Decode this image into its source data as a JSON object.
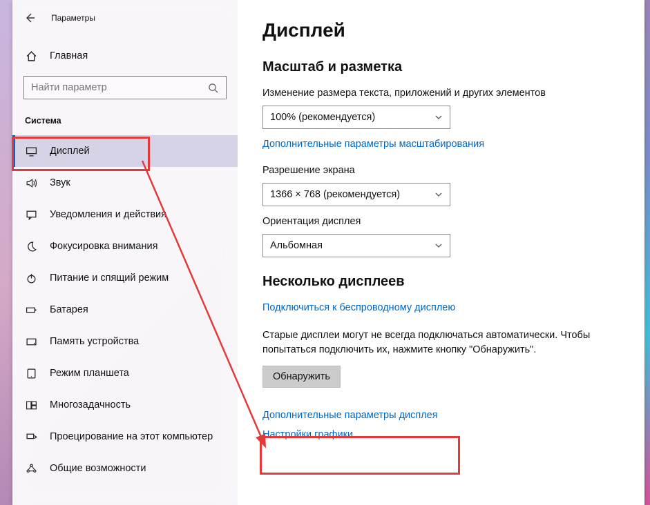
{
  "window": {
    "title": "Параметры"
  },
  "home": {
    "label": "Главная"
  },
  "search": {
    "placeholder": "Найти параметр"
  },
  "category": {
    "label": "Система"
  },
  "nav": [
    {
      "id": "display",
      "label": "Дисплей",
      "icon": "monitor",
      "active": true
    },
    {
      "id": "sound",
      "label": "Звук",
      "icon": "speaker",
      "active": false
    },
    {
      "id": "notifications",
      "label": "Уведомления и действия",
      "icon": "chat",
      "active": false
    },
    {
      "id": "focus",
      "label": "Фокусировка внимания",
      "icon": "moon",
      "active": false
    },
    {
      "id": "power",
      "label": "Питание и спящий режим",
      "icon": "power",
      "active": false
    },
    {
      "id": "battery",
      "label": "Батарея",
      "icon": "battery",
      "active": false
    },
    {
      "id": "storage",
      "label": "Память устройства",
      "icon": "storage",
      "active": false
    },
    {
      "id": "tablet",
      "label": "Режим планшета",
      "icon": "tablet",
      "active": false
    },
    {
      "id": "multitask",
      "label": "Многозадачность",
      "icon": "multitask",
      "active": false
    },
    {
      "id": "project",
      "label": "Проецирование на этот компьютер",
      "icon": "project",
      "active": false
    },
    {
      "id": "shared",
      "label": "Общие возможности",
      "icon": "shared",
      "active": false
    }
  ],
  "main": {
    "title": "Дисплей",
    "scale_section": "Масштаб и разметка",
    "scale_label": "Изменение размера текста, приложений и других элементов",
    "scale_value": "100% (рекомендуется)",
    "scale_advanced_link": "Дополнительные параметры масштабирования",
    "resolution_label": "Разрешение экрана",
    "resolution_value": "1366 × 768 (рекомендуется)",
    "orientation_label": "Ориентация дисплея",
    "orientation_value": "Альбомная",
    "multi_section": "Несколько дисплеев",
    "wireless_link": "Подключиться к беспроводному дисплею",
    "detect_help": "Старые дисплеи могут не всегда подключаться автоматически. Чтобы попытаться подключить их, нажмите кнопку \"Обнаружить\".",
    "detect_btn": "Обнаружить",
    "advanced_display_link": "Дополнительные параметры дисплея",
    "graphics_link": "Настройки графики"
  }
}
